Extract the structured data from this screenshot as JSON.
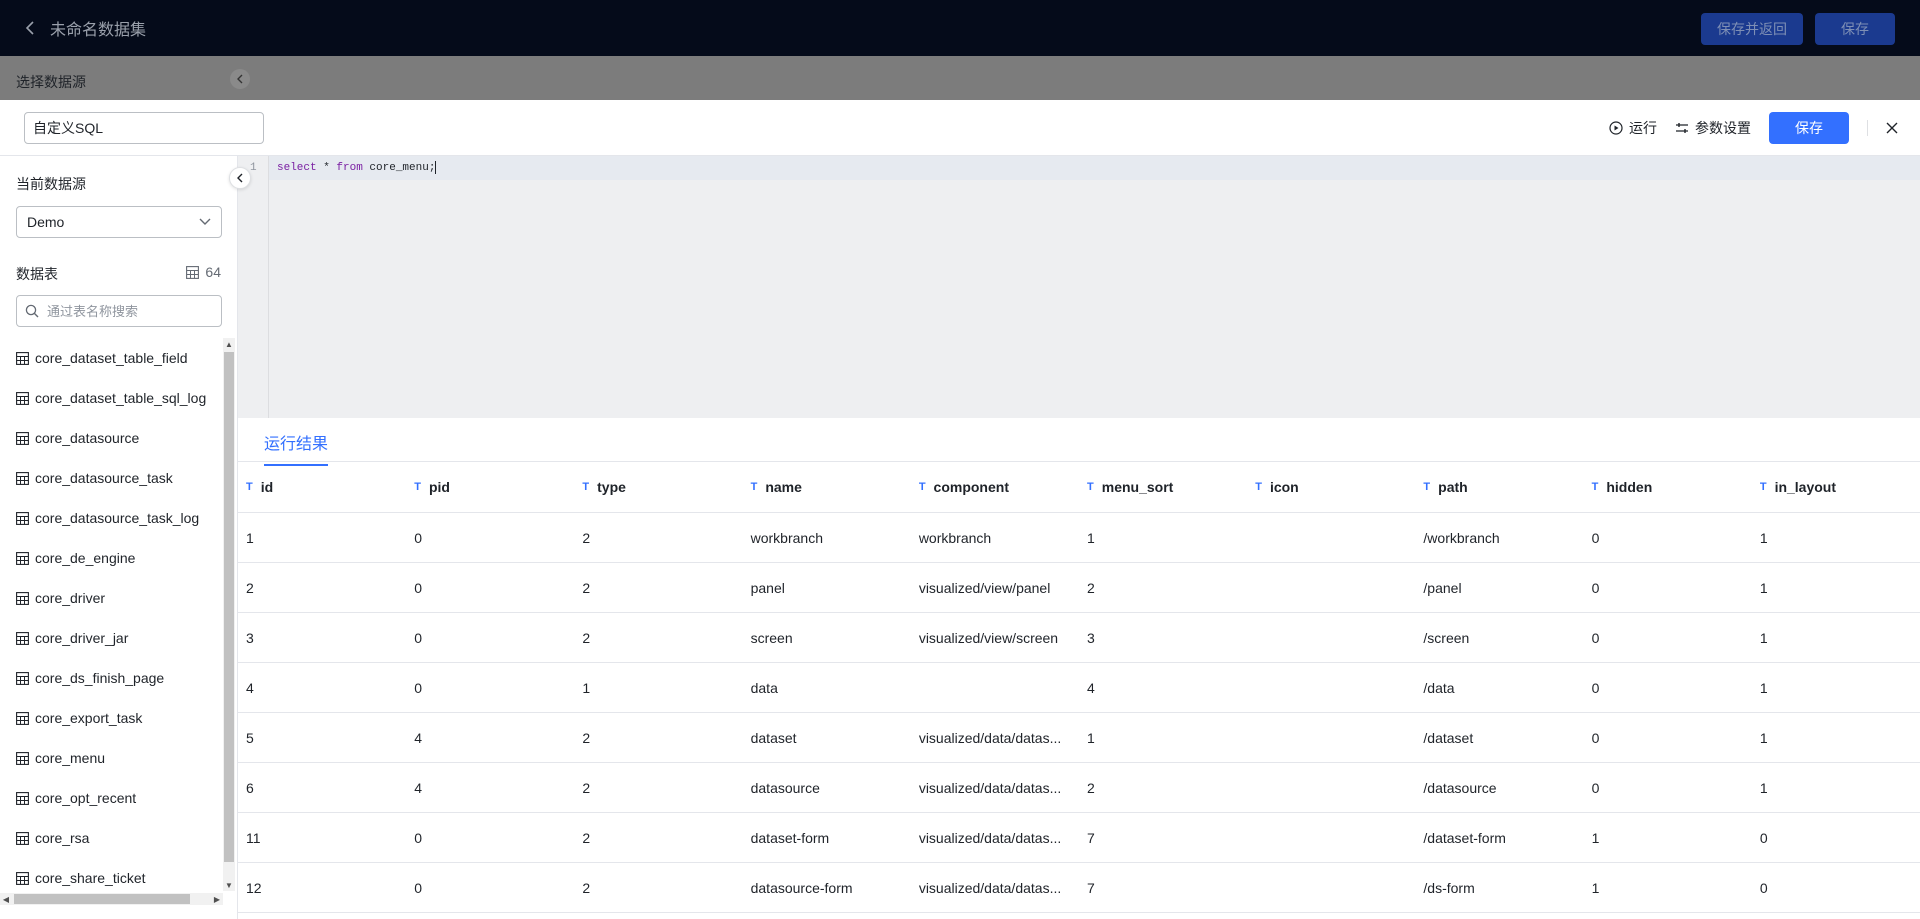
{
  "header": {
    "title": "未命名数据集",
    "save_return_label": "保存并返回",
    "save_label": "保存"
  },
  "overlay": {
    "label": "选择数据源"
  },
  "drawer": {
    "name_value": "自定义SQL",
    "run_label": "运行",
    "params_label": "参数设置",
    "save_label": "保存"
  },
  "left_panel": {
    "current_source_label": "当前数据源",
    "selected_source": "Demo",
    "tables_label": "数据表",
    "table_count": "64",
    "search_placeholder": "通过表名称搜索",
    "tables": [
      "core_dataset_table_field",
      "core_dataset_table_sql_log",
      "core_datasource",
      "core_datasource_task",
      "core_datasource_task_log",
      "core_de_engine",
      "core_driver",
      "core_driver_jar",
      "core_ds_finish_page",
      "core_export_task",
      "core_menu",
      "core_opt_recent",
      "core_rsa",
      "core_share_ticket"
    ]
  },
  "editor": {
    "line_number": "1",
    "code_keyword_select": "select",
    "code_star": " * ",
    "code_keyword_from": "from",
    "code_table": " core_menu;"
  },
  "results": {
    "tab_label": "运行结果",
    "type_icon": "T",
    "columns": [
      "id",
      "pid",
      "type",
      "name",
      "component",
      "menu_sort",
      "icon",
      "path",
      "hidden",
      "in_layout"
    ],
    "rows": [
      [
        "1",
        "0",
        "2",
        "workbranch",
        "workbranch",
        "1",
        "",
        "/workbranch",
        "0",
        "1"
      ],
      [
        "2",
        "0",
        "2",
        "panel",
        "visualized/view/panel",
        "2",
        "",
        "/panel",
        "0",
        "1"
      ],
      [
        "3",
        "0",
        "2",
        "screen",
        "visualized/view/screen",
        "3",
        "",
        "/screen",
        "0",
        "1"
      ],
      [
        "4",
        "0",
        "1",
        "data",
        "",
        "4",
        "",
        "/data",
        "0",
        "1"
      ],
      [
        "5",
        "4",
        "2",
        "dataset",
        "visualized/data/datas...",
        "1",
        "",
        "/dataset",
        "0",
        "1"
      ],
      [
        "6",
        "4",
        "2",
        "datasource",
        "visualized/data/datas...",
        "2",
        "",
        "/datasource",
        "0",
        "1"
      ],
      [
        "11",
        "0",
        "2",
        "dataset-form",
        "visualized/data/datas...",
        "7",
        "",
        "/dataset-form",
        "1",
        "0"
      ],
      [
        "12",
        "0",
        "2",
        "datasource-form",
        "visualized/data/datas...",
        "7",
        "",
        "/ds-form",
        "1",
        "0"
      ]
    ]
  },
  "colors": {
    "header_bg": "#050b1a",
    "primary": "#3370ff",
    "overlay_gray": "#7c7c7c",
    "editor_bg": "#eeeff1"
  }
}
